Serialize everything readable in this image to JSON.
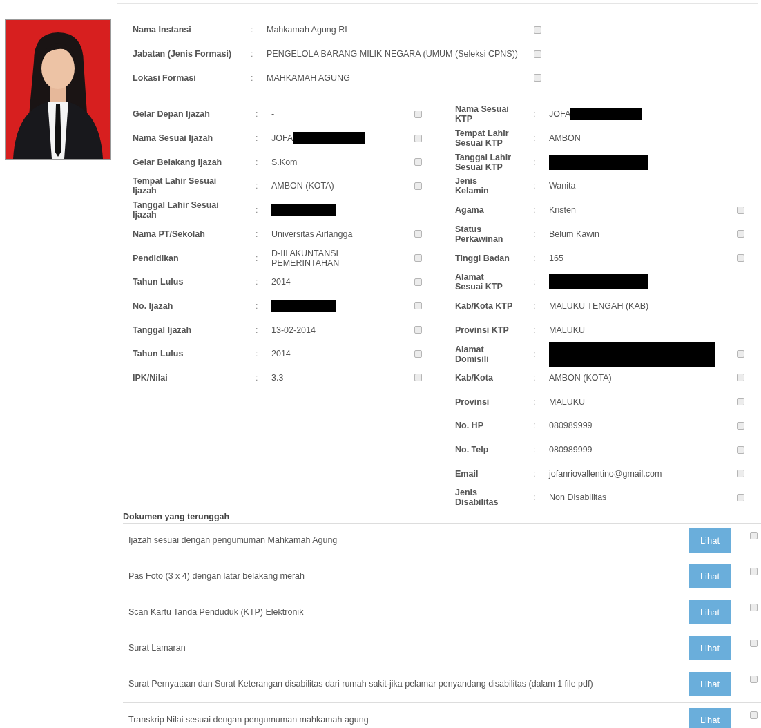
{
  "top_fields": [
    {
      "label": "Nama Instansi",
      "separator": ":",
      "value": "Mahkamah Agung RI",
      "checked": false
    },
    {
      "label": "Jabatan (Jenis Formasi)",
      "separator": ":",
      "value": "PENGELOLA BARANG MILIK NEGARA (UMUM (Seleksi CPNS))",
      "checked": false
    },
    {
      "label": "Lokasi Formasi",
      "separator": ":",
      "value": "MAHKAMAH AGUNG",
      "checked": false
    }
  ],
  "left_fields": [
    {
      "label": "Gelar Depan Ijazah",
      "separator": ":",
      "value": "-",
      "checked": false
    },
    {
      "label": "Nama Sesuai Ijazah",
      "separator": ":",
      "value": "JOFA",
      "redacted": true,
      "checked": false
    },
    {
      "label": "Gelar Belakang Ijazah",
      "separator": ":",
      "value": "S.Kom",
      "checked": false
    },
    {
      "label": "Tempat Lahir Sesuai Ijazah",
      "separator": ":",
      "value": "AMBON (KOTA)",
      "checked": false
    },
    {
      "label": "Tanggal Lahir Sesuai Ijazah",
      "separator": ":",
      "redacted": true
    },
    {
      "label": "Nama PT/Sekolah",
      "separator": ":",
      "value": "Universitas Airlangga",
      "checked": false
    },
    {
      "label": "Pendidikan",
      "separator": ":",
      "value": "D-III AKUNTANSI PEMERINTAHAN",
      "checked": false
    },
    {
      "label": "Tahun Lulus",
      "separator": ":",
      "value": "2014",
      "checked": false
    },
    {
      "label": "No. Ijazah",
      "separator": ":",
      "redacted": true,
      "checked": false
    },
    {
      "label": "Tanggal Ijazah",
      "separator": ":",
      "value": "13-02-2014",
      "checked": false
    },
    {
      "label": "Tahun Lulus",
      "separator": ":",
      "value": "2014",
      "checked": false
    },
    {
      "label": "IPK/Nilai",
      "separator": ":",
      "value": "3.3",
      "checked": false
    }
  ],
  "right_fields": [
    {
      "label": "Nama Sesuai KTP",
      "separator": ":",
      "value": "JOFA",
      "redacted": true
    },
    {
      "label": "Tempat Lahir Sesuai KTP",
      "separator": ":",
      "value": "AMBON"
    },
    {
      "label": "Tanggal Lahir Sesuai KTP",
      "separator": ":",
      "redacted": true
    },
    {
      "label": "Jenis Kelamin",
      "separator": ":",
      "value": "Wanita"
    },
    {
      "label": "Agama",
      "separator": ":",
      "value": "Kristen",
      "checked": false
    },
    {
      "label": "Status Perkawinan",
      "separator": ":",
      "value": "Belum Kawin",
      "checked": false
    },
    {
      "label": "Tinggi Badan",
      "separator": ":",
      "value": "165",
      "checked": false
    },
    {
      "label": "Alamat Sesuai KTP",
      "separator": ":",
      "redacted": true
    },
    {
      "label": "Kab/Kota KTP",
      "separator": ":",
      "value": "MALUKU TENGAH (KAB)"
    },
    {
      "label": "Provinsi KTP",
      "separator": ":",
      "value": "MALUKU"
    },
    {
      "label": "Alamat Domisili",
      "separator": ":",
      "redacted": true,
      "checked": false
    },
    {
      "label": "Kab/Kota",
      "separator": ":",
      "value": "AMBON (KOTA)",
      "checked": false
    },
    {
      "label": "Provinsi",
      "separator": ":",
      "value": "MALUKU",
      "checked": false
    },
    {
      "label": "No. HP",
      "separator": ":",
      "value": "080989999",
      "checked": false
    },
    {
      "label": "No. Telp",
      "separator": ":",
      "value": "080989999",
      "checked": false
    },
    {
      "label": "Email",
      "separator": ":",
      "value": "jofanriovallentino@gmail.com",
      "checked": false
    },
    {
      "label": "Jenis Disabilitas",
      "separator": ":",
      "value": "Non Disabilitas",
      "checked": false
    }
  ],
  "documents": {
    "title": "Dokumen yang terunggah",
    "rows": [
      {
        "name": "Ijazah sesuai dengan pengumuman Mahkamah Agung",
        "button": "Lihat",
        "checked": false
      },
      {
        "name": "Pas Foto (3 x 4) dengan latar belakang merah",
        "button": "Lihat",
        "checked": false
      },
      {
        "name": "Scan Kartu Tanda Penduduk (KTP) Elektronik",
        "button": "Lihat",
        "checked": false
      },
      {
        "name": "Surat Lamaran",
        "button": "Lihat",
        "checked": false
      },
      {
        "name": "Surat Pernyataan dan Surat Keterangan disabilitas dari rumah sakit-jika pelamar penyandang disabilitas (dalam 1 file pdf)",
        "button": "Lihat",
        "checked": false
      },
      {
        "name": "Transkrip Nilai sesuai dengan pengumuman mahkamah agung",
        "button": "Lihat",
        "checked": false
      }
    ]
  }
}
